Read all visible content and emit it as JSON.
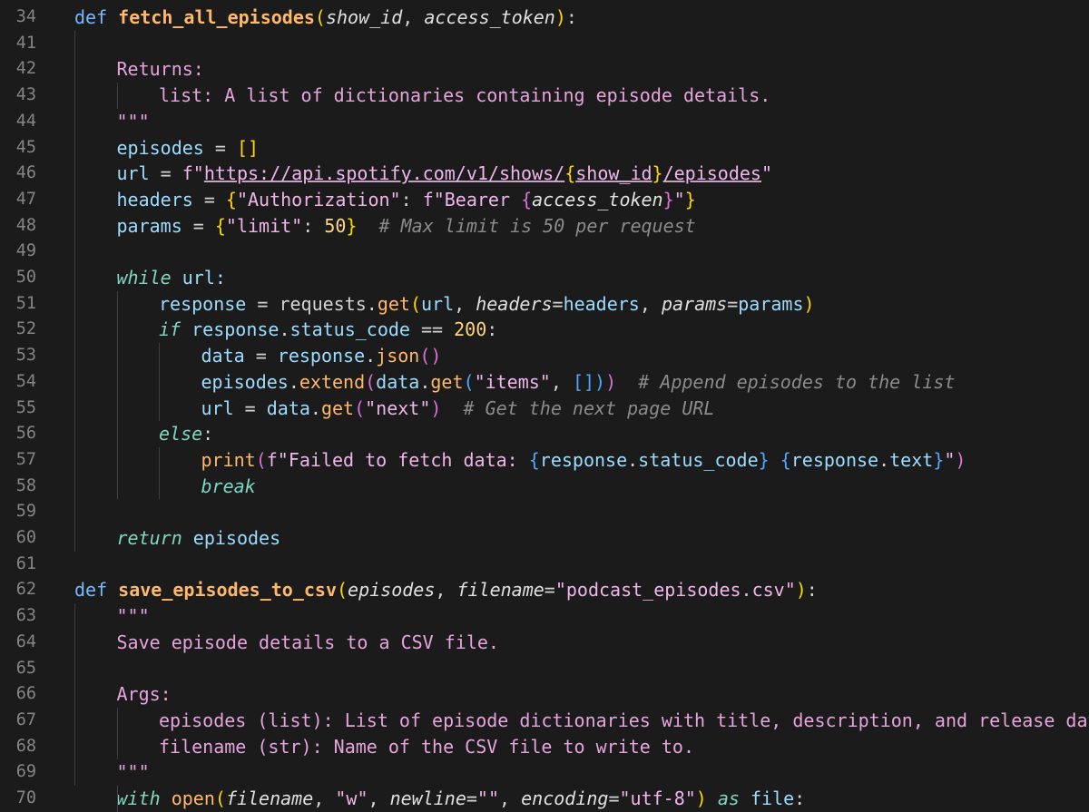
{
  "editor": {
    "lines": [
      {
        "n": "34",
        "indent": 0,
        "tokens": [
          [
            "def ",
            "keyword"
          ],
          [
            "fetch_all_episodes",
            "func"
          ],
          [
            "(",
            "bracket"
          ],
          [
            "show_id",
            "param"
          ],
          [
            ", ",
            "plain"
          ],
          [
            "access_token",
            "param"
          ],
          [
            ")",
            "bracket"
          ],
          [
            ":",
            "plain"
          ]
        ]
      },
      {
        "n": "41",
        "indent": 0,
        "tokens": []
      },
      {
        "n": "42",
        "indent": 1,
        "tokens": [
          [
            "Returns:",
            "doc"
          ]
        ]
      },
      {
        "n": "43",
        "indent": 2,
        "tokens": [
          [
            "list: A list of dictionaries containing episode details.",
            "doc"
          ]
        ]
      },
      {
        "n": "44",
        "indent": 1,
        "tokens": [
          [
            "\"\"\"",
            "doc"
          ]
        ]
      },
      {
        "n": "45",
        "indent": 1,
        "tokens": [
          [
            "episodes",
            "var"
          ],
          [
            " = ",
            "op"
          ],
          [
            "[]",
            "bracket"
          ]
        ]
      },
      {
        "n": "46",
        "indent": 1,
        "tokens": [
          [
            "url",
            "var"
          ],
          [
            " = ",
            "op"
          ],
          [
            "f\"",
            "string"
          ],
          [
            "https://api.spotify.com/v1/shows/",
            "url"
          ],
          [
            "{",
            "bracket"
          ],
          [
            "show_id",
            "url"
          ],
          [
            "}",
            "bracket"
          ],
          [
            "/episodes",
            "url"
          ],
          [
            "\"",
            "string"
          ]
        ]
      },
      {
        "n": "47",
        "indent": 1,
        "tokens": [
          [
            "headers",
            "var"
          ],
          [
            " = ",
            "op"
          ],
          [
            "{",
            "bracket"
          ],
          [
            "\"Authorization\"",
            "string"
          ],
          [
            ": ",
            "plain"
          ],
          [
            "f\"Bearer ",
            "string"
          ],
          [
            "{",
            "bracket2"
          ],
          [
            "access_token",
            "param"
          ],
          [
            "}",
            "bracket2"
          ],
          [
            "\"",
            "string"
          ],
          [
            "}",
            "bracket"
          ]
        ]
      },
      {
        "n": "48",
        "indent": 1,
        "tokens": [
          [
            "params",
            "var"
          ],
          [
            " = ",
            "op"
          ],
          [
            "{",
            "bracket"
          ],
          [
            "\"limit\"",
            "string"
          ],
          [
            ": ",
            "plain"
          ],
          [
            "50",
            "number"
          ],
          [
            "}",
            "bracket"
          ],
          [
            "  # Max limit is 50 per request",
            "comment"
          ]
        ]
      },
      {
        "n": "49",
        "indent": 0,
        "tokens": []
      },
      {
        "n": "50",
        "indent": 1,
        "tokens": [
          [
            "while",
            "keyword-it"
          ],
          [
            " url:",
            "var"
          ]
        ]
      },
      {
        "n": "51",
        "indent": 2,
        "tokens": [
          [
            "response",
            "var"
          ],
          [
            " = ",
            "op"
          ],
          [
            "requests",
            "plain"
          ],
          [
            ".",
            "plain"
          ],
          [
            "get",
            "method"
          ],
          [
            "(",
            "bracket"
          ],
          [
            "url",
            "var"
          ],
          [
            ", ",
            "plain"
          ],
          [
            "headers",
            "param"
          ],
          [
            "=",
            "op"
          ],
          [
            "headers",
            "var"
          ],
          [
            ", ",
            "plain"
          ],
          [
            "params",
            "param"
          ],
          [
            "=",
            "op"
          ],
          [
            "params",
            "var"
          ],
          [
            ")",
            "bracket"
          ]
        ]
      },
      {
        "n": "52",
        "indent": 2,
        "tokens": [
          [
            "if",
            "keyword-it"
          ],
          [
            " response",
            "var"
          ],
          [
            ".",
            "plain"
          ],
          [
            "status_code",
            "var"
          ],
          [
            " == ",
            "op"
          ],
          [
            "200",
            "number"
          ],
          [
            ":",
            "plain"
          ]
        ]
      },
      {
        "n": "53",
        "indent": 3,
        "tokens": [
          [
            "data",
            "var"
          ],
          [
            " = ",
            "op"
          ],
          [
            "response",
            "var"
          ],
          [
            ".",
            "plain"
          ],
          [
            "json",
            "method"
          ],
          [
            "()",
            "bracket2"
          ]
        ]
      },
      {
        "n": "54",
        "indent": 3,
        "tokens": [
          [
            "episodes",
            "var"
          ],
          [
            ".",
            "plain"
          ],
          [
            "extend",
            "method"
          ],
          [
            "(",
            "bracket2"
          ],
          [
            "data",
            "var"
          ],
          [
            ".",
            "plain"
          ],
          [
            "get",
            "method"
          ],
          [
            "(",
            "bracket3"
          ],
          [
            "\"items\"",
            "string"
          ],
          [
            ", ",
            "plain"
          ],
          [
            "[]",
            "bracket3"
          ],
          [
            ")",
            "bracket3"
          ],
          [
            ")",
            "bracket2"
          ],
          [
            "  # Append episodes to the list",
            "comment"
          ]
        ]
      },
      {
        "n": "55",
        "indent": 3,
        "tokens": [
          [
            "url",
            "var"
          ],
          [
            " = ",
            "op"
          ],
          [
            "data",
            "var"
          ],
          [
            ".",
            "plain"
          ],
          [
            "get",
            "method"
          ],
          [
            "(",
            "bracket2"
          ],
          [
            "\"next\"",
            "string"
          ],
          [
            ")",
            "bracket2"
          ],
          [
            "  # Get the next page URL",
            "comment"
          ]
        ]
      },
      {
        "n": "56",
        "indent": 2,
        "tokens": [
          [
            "else",
            "keyword-it"
          ],
          [
            ":",
            "plain"
          ]
        ]
      },
      {
        "n": "57",
        "indent": 3,
        "tokens": [
          [
            "print",
            "method"
          ],
          [
            "(",
            "bracket2"
          ],
          [
            "f\"Failed to fetch data: ",
            "string"
          ],
          [
            "{",
            "bracket3"
          ],
          [
            "response",
            "var"
          ],
          [
            ".",
            "plain"
          ],
          [
            "status_code",
            "var"
          ],
          [
            "}",
            "bracket3"
          ],
          [
            " ",
            "string"
          ],
          [
            "{",
            "bracket3"
          ],
          [
            "response",
            "var"
          ],
          [
            ".",
            "plain"
          ],
          [
            "text",
            "var"
          ],
          [
            "}",
            "bracket3"
          ],
          [
            "\"",
            "string"
          ],
          [
            ")",
            "bracket2"
          ]
        ]
      },
      {
        "n": "58",
        "indent": 3,
        "tokens": [
          [
            "break",
            "keyword-it"
          ]
        ]
      },
      {
        "n": "59",
        "indent": 0,
        "tokens": []
      },
      {
        "n": "60",
        "indent": 1,
        "tokens": [
          [
            "return",
            "keyword-it"
          ],
          [
            " episodes",
            "var"
          ]
        ]
      },
      {
        "n": "61",
        "indent": 0,
        "tokens": []
      },
      {
        "n": "62",
        "indent": 0,
        "tokens": [
          [
            "def ",
            "keyword"
          ],
          [
            "save_episodes_to_csv",
            "func"
          ],
          [
            "(",
            "bracket"
          ],
          [
            "episodes",
            "param"
          ],
          [
            ", ",
            "plain"
          ],
          [
            "filename",
            "param"
          ],
          [
            "=",
            "op"
          ],
          [
            "\"podcast_episodes.csv\"",
            "string"
          ],
          [
            ")",
            "bracket"
          ],
          [
            ":",
            "plain"
          ]
        ]
      },
      {
        "n": "63",
        "indent": 1,
        "tokens": [
          [
            "\"\"\"",
            "doc"
          ]
        ]
      },
      {
        "n": "64",
        "indent": 1,
        "tokens": [
          [
            "Save episode details to a CSV file.",
            "doc"
          ]
        ]
      },
      {
        "n": "65",
        "indent": 0,
        "tokens": []
      },
      {
        "n": "66",
        "indent": 1,
        "tokens": [
          [
            "Args:",
            "doc"
          ]
        ]
      },
      {
        "n": "67",
        "indent": 2,
        "tokens": [
          [
            "episodes (list): List of episode dictionaries with title, description, and release date.",
            "doc"
          ]
        ]
      },
      {
        "n": "68",
        "indent": 2,
        "tokens": [
          [
            "filename (str): Name of the CSV file to write to.",
            "doc"
          ]
        ]
      },
      {
        "n": "69",
        "indent": 1,
        "tokens": [
          [
            "\"\"\"",
            "doc"
          ]
        ]
      },
      {
        "n": "70",
        "indent": 1,
        "tokens": [
          [
            "with",
            "keyword-it"
          ],
          [
            " open",
            "method"
          ],
          [
            "(",
            "bracket"
          ],
          [
            "filename",
            "param"
          ],
          [
            ", ",
            "plain"
          ],
          [
            "\"w\"",
            "string"
          ],
          [
            ", ",
            "plain"
          ],
          [
            "newline",
            "param"
          ],
          [
            "=",
            "op"
          ],
          [
            "\"\"",
            "string"
          ],
          [
            ", ",
            "plain"
          ],
          [
            "encoding",
            "param"
          ],
          [
            "=",
            "op"
          ],
          [
            "\"utf-8\"",
            "string"
          ],
          [
            ")",
            "bracket"
          ],
          [
            " as",
            "keyword-it"
          ],
          [
            " file",
            "var"
          ],
          [
            ":",
            "plain"
          ]
        ]
      }
    ]
  }
}
